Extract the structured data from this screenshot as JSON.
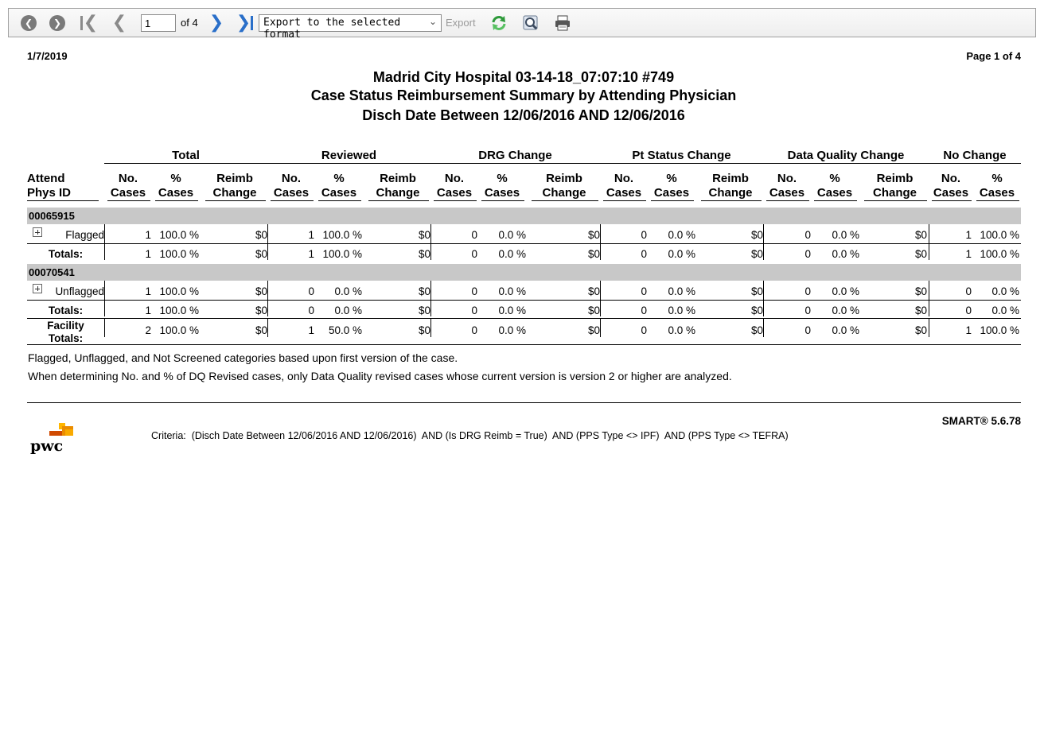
{
  "toolbar": {
    "page_value": "1",
    "page_of": "of 4",
    "export_format": "Export to the selected format",
    "export_label": "Export",
    "icons": [
      "back-icon",
      "forward-icon",
      "first-page-icon",
      "prev-page-icon",
      "next-page-icon",
      "last-page-icon",
      "refresh-icon",
      "search-icon",
      "print-icon"
    ]
  },
  "report": {
    "date": "1/7/2019",
    "page": "Page 1 of 4",
    "title1": "Madrid City Hospital 03-14-18_07:07:10 #749",
    "title2": "Case Status Reimbursement Summary by Attending Physician",
    "title3": "Disch Date Between 12/06/2016 AND 12/06/2016",
    "group_headers": [
      "Total",
      "Reviewed",
      "DRG Change",
      "Pt Status Change",
      "Data Quality Change",
      "No Change"
    ],
    "attend_header": [
      "Attend",
      "Phys ID"
    ],
    "column_headers": [
      [
        "No.",
        "Cases"
      ],
      [
        "%",
        "Cases"
      ],
      [
        "Reimb",
        "Change"
      ],
      [
        "No.",
        "Cases"
      ],
      [
        "%",
        "Cases"
      ],
      [
        "Reimb",
        "Change"
      ],
      [
        "No.",
        "Cases"
      ],
      [
        "%",
        "Cases"
      ],
      [
        "Reimb",
        "Change"
      ],
      [
        "No.",
        "Cases"
      ],
      [
        "%",
        "Cases"
      ],
      [
        "Reimb",
        "Change"
      ],
      [
        "No.",
        "Cases"
      ],
      [
        "%",
        "Cases"
      ],
      [
        "Reimb",
        "Change"
      ],
      [
        "No.",
        "Cases"
      ],
      [
        "%",
        "Cases"
      ]
    ],
    "physicians": [
      {
        "id": "00065915",
        "row_label": "Flagged",
        "row": [
          "1",
          "100.0 %",
          "$0",
          "1",
          "100.0 %",
          "$0",
          "0",
          "0.0 %",
          "$0",
          "0",
          "0.0 %",
          "$0",
          "0",
          "0.0 %",
          "$0",
          "1",
          "100.0 %"
        ],
        "totals_label": "Totals:",
        "totals": [
          "1",
          "100.0 %",
          "$0",
          "1",
          "100.0 %",
          "$0",
          "0",
          "0.0 %",
          "$0",
          "0",
          "0.0 %",
          "$0",
          "0",
          "0.0 %",
          "$0",
          "1",
          "100.0 %"
        ]
      },
      {
        "id": "00070541",
        "row_label": "Unflagged",
        "row": [
          "1",
          "100.0 %",
          "$0",
          "0",
          "0.0 %",
          "$0",
          "0",
          "0.0 %",
          "$0",
          "0",
          "0.0 %",
          "$0",
          "0",
          "0.0 %",
          "$0",
          "0",
          "0.0 %"
        ],
        "totals_label": "Totals:",
        "totals": [
          "1",
          "100.0 %",
          "$0",
          "0",
          "0.0 %",
          "$0",
          "0",
          "0.0 %",
          "$0",
          "0",
          "0.0 %",
          "$0",
          "0",
          "0.0 %",
          "$0",
          "0",
          "0.0 %"
        ]
      }
    ],
    "facility_label": [
      "Facility",
      "Totals:"
    ],
    "facility_totals": [
      "2",
      "100.0 %",
      "$0",
      "1",
      "50.0 %",
      "$0",
      "0",
      "0.0 %",
      "$0",
      "0",
      "0.0 %",
      "$0",
      "0",
      "0.0 %",
      "$0",
      "1",
      "100.0 %"
    ],
    "note1": "Flagged, Unflagged, and Not Screened categories based upon first version of the case.",
    "note2": "When determining No. and % of DQ Revised cases, only Data Quality revised cases whose current version is version 2 or higher are analyzed.",
    "criteria": "Criteria:  (Disch Date Between 12/06/2016 AND 12/06/2016)  AND (Is DRG Reimb = True)  AND (PPS Type <> IPF)  AND (PPS Type <> TEFRA)",
    "version": "SMART® 5.6.78",
    "logo": "pwc"
  }
}
